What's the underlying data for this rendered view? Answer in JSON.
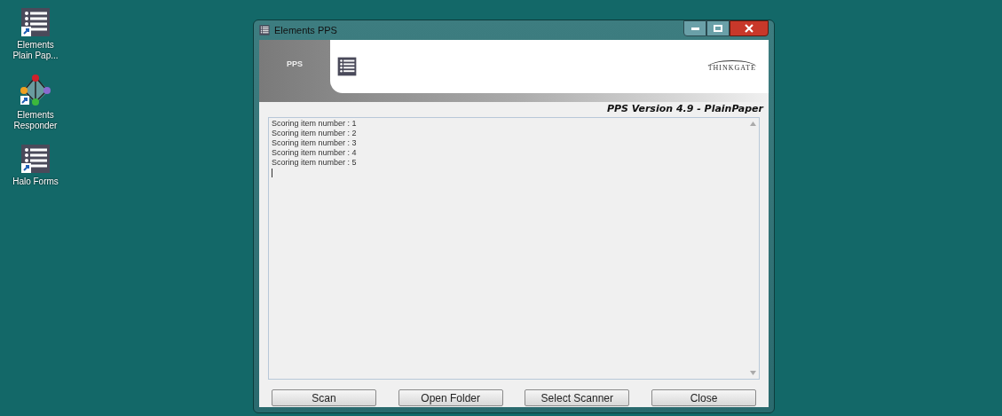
{
  "desktop_icons": [
    {
      "kind": "list",
      "label": "Elements Plain Pap..."
    },
    {
      "kind": "network",
      "label": "Elements Responder"
    },
    {
      "kind": "list",
      "label": "Halo Forms"
    }
  ],
  "window": {
    "title": "Elements PPS"
  },
  "header": {
    "tab": "PPS",
    "logo": "THINKGATE",
    "version": "PPS Version 4.9 - PlainPaper"
  },
  "log": {
    "lines": [
      "Scoring item number : 1",
      "Scoring item number : 2",
      "Scoring item number : 3",
      "Scoring item number : 4",
      "Scoring item number : 5"
    ]
  },
  "buttons": [
    "Scan",
    "Open Folder",
    "Select Scanner",
    "Close"
  ]
}
